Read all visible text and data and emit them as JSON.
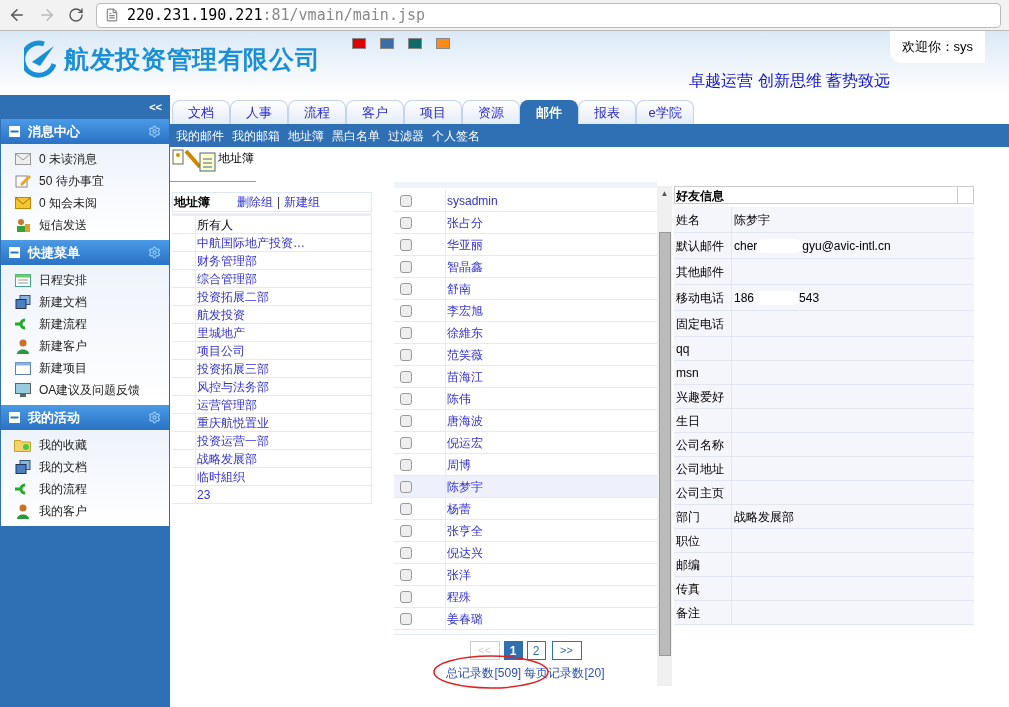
{
  "browser": {
    "url_host": "220.231.190.221",
    "url_path": ":81/vmain/main.jsp"
  },
  "header": {
    "company": "航发投资管理有限公司",
    "slogan": "卓越运营 创新思维 蓄势致远",
    "welcome": "欢迎你：sys",
    "themes": [
      {
        "color": "#e00000",
        "selected": false
      },
      {
        "color": "#3a6ea5",
        "selected": false
      },
      {
        "color": "#0e6b66",
        "selected": false
      },
      {
        "color": "#ff8a1a",
        "selected": false
      }
    ]
  },
  "sidebar": {
    "collapse": "<<",
    "sections": [
      {
        "title": "消息中心",
        "items": [
          {
            "kind": "mail",
            "label": "0 未读消息"
          },
          {
            "kind": "note",
            "label": "50 待办事宜"
          },
          {
            "kind": "envelope",
            "label": "0 知会未阅"
          },
          {
            "kind": "sms",
            "label": "短信发送"
          }
        ]
      },
      {
        "title": "快捷菜单",
        "items": [
          {
            "kind": "calendar",
            "label": "日程安排"
          },
          {
            "kind": "docs",
            "label": "新建文档"
          },
          {
            "kind": "flow",
            "label": "新建流程"
          },
          {
            "kind": "person",
            "label": "新建客户"
          },
          {
            "kind": "window",
            "label": "新建项目"
          },
          {
            "kind": "monitor",
            "label": "OA建议及问题反馈"
          }
        ]
      },
      {
        "title": "我的活动",
        "items": [
          {
            "kind": "folder",
            "label": "我的收藏"
          },
          {
            "kind": "docs",
            "label": "我的文档"
          },
          {
            "kind": "flow",
            "label": "我的流程"
          },
          {
            "kind": "person",
            "label": "我的客户"
          }
        ]
      }
    ]
  },
  "tabs": [
    {
      "label": "文档",
      "selected": false
    },
    {
      "label": "人事",
      "selected": false
    },
    {
      "label": "流程",
      "selected": false
    },
    {
      "label": "客户",
      "selected": false
    },
    {
      "label": "项目",
      "selected": false
    },
    {
      "label": "资源",
      "selected": false
    },
    {
      "label": "邮件",
      "selected": true
    },
    {
      "label": "报表",
      "selected": false
    },
    {
      "label": "e学院",
      "selected": false
    }
  ],
  "subnav": [
    "我的邮件",
    "我的邮箱",
    "地址簿",
    "黑白名单",
    "过滤器",
    "个人签名"
  ],
  "toolbar": {
    "title": "地址簿"
  },
  "groups": {
    "title": "地址簿",
    "actions": [
      "删除组",
      "新建组"
    ],
    "separator": "|",
    "items": [
      {
        "label": "所有人",
        "link": false
      },
      {
        "label": "中航国际地产投资…",
        "link": true
      },
      {
        "label": "财务管理部",
        "link": true
      },
      {
        "label": "综合管理部",
        "link": true
      },
      {
        "label": "投资拓展二部",
        "link": true
      },
      {
        "label": "航发投资",
        "link": true
      },
      {
        "label": "里城地产",
        "link": true
      },
      {
        "label": "项目公司",
        "link": true
      },
      {
        "label": "投资拓展三部",
        "link": true
      },
      {
        "label": "风控与法务部",
        "link": true
      },
      {
        "label": "运营管理部",
        "link": true
      },
      {
        "label": "重庆航悦置业",
        "link": true
      },
      {
        "label": "投资运营一部",
        "link": true
      },
      {
        "label": "战略发展部",
        "link": true
      },
      {
        "label": "临时組织",
        "link": true
      },
      {
        "label": "23",
        "link": true
      }
    ]
  },
  "contacts": {
    "rows": [
      {
        "name": "sysadmin",
        "selected": false,
        "checked": false
      },
      {
        "name": "张占分",
        "selected": false,
        "checked": false
      },
      {
        "name": "华亚丽",
        "selected": false,
        "checked": false
      },
      {
        "name": "智晶鑫",
        "selected": false,
        "checked": false
      },
      {
        "name": "舒南",
        "selected": false,
        "checked": false
      },
      {
        "name": "李宏旭",
        "selected": false,
        "checked": false
      },
      {
        "name": "徐維东",
        "selected": false,
        "checked": false
      },
      {
        "name": "范笑薇",
        "selected": false,
        "checked": false
      },
      {
        "name": "苗海江",
        "selected": false,
        "checked": false
      },
      {
        "name": "陈伟",
        "selected": false,
        "checked": false
      },
      {
        "name": "唐海波",
        "selected": false,
        "checked": false
      },
      {
        "name": "倪运宏",
        "selected": false,
        "checked": false
      },
      {
        "name": "周博",
        "selected": false,
        "checked": false
      },
      {
        "name": "陈梦宇",
        "selected": true,
        "checked": false
      },
      {
        "name": "杨蕾",
        "selected": false,
        "checked": false
      },
      {
        "name": "张亨全",
        "selected": false,
        "checked": false
      },
      {
        "name": "倪达兴",
        "selected": false,
        "checked": false
      },
      {
        "name": "张洋",
        "selected": false,
        "checked": false
      },
      {
        "name": "程殊",
        "selected": false,
        "checked": false
      },
      {
        "name": "姜春璐",
        "selected": false,
        "checked": false
      }
    ],
    "scroll_up": "▲",
    "pager": {
      "prev": "<<",
      "pages": [
        {
          "label": "1",
          "selected": true
        },
        {
          "label": "2",
          "selected": false
        }
      ],
      "next": ">>",
      "total": "总记录数[509] 每页记录数[20]"
    }
  },
  "friend_info": {
    "title": "好友信息",
    "fields": [
      {
        "label": "姓名",
        "value": [
          "陈梦宇"
        ]
      },
      {
        "label": "默认邮件",
        "value": [
          "cher",
          "gyu@avic-intl.cn"
        ]
      },
      {
        "label": "其他邮件"
      },
      {
        "label": "移动电话",
        "value": [
          "186",
          "543"
        ]
      },
      {
        "label": "固定电话"
      },
      {
        "label": "qq"
      },
      {
        "label": "msn"
      },
      {
        "label": "兴趣爱好"
      },
      {
        "label": "生日"
      },
      {
        "label": "公司名称"
      },
      {
        "label": "公司地址"
      },
      {
        "label": "公司主页"
      },
      {
        "label": "部门",
        "value": [
          "战略发展部"
        ]
      },
      {
        "label": "职位"
      },
      {
        "label": "邮编"
      },
      {
        "label": "传真"
      },
      {
        "label": "备注"
      }
    ]
  }
}
